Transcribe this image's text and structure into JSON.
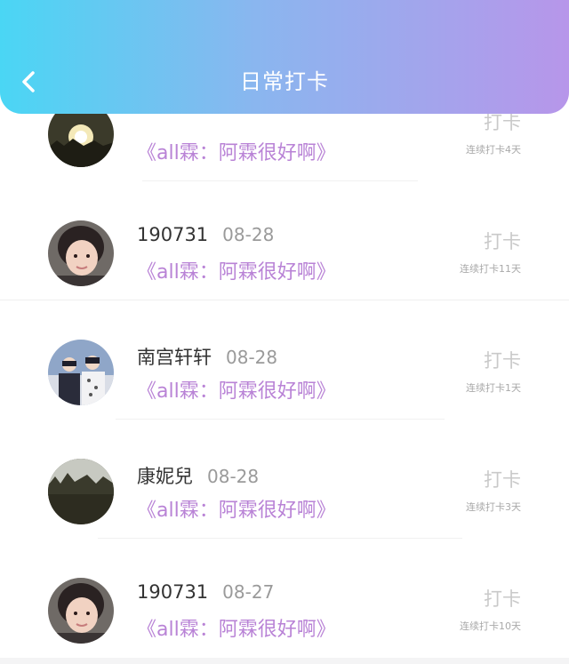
{
  "header": {
    "title": "日常打卡"
  },
  "rows": [
    {
      "name": "",
      "date": "",
      "book": "《all霖：阿霖很好啊》",
      "action": "打卡",
      "streak": "连续打卡4天",
      "avatar": "sunset"
    },
    {
      "name": "190731",
      "date": "08-28",
      "book": "《all霖：阿霖很好啊》",
      "action": "打卡",
      "streak": "连续打卡11天",
      "avatar": "girl"
    },
    {
      "name": "南宫轩轩",
      "date": "08-28",
      "book": "《all霖：阿霖很好啊》",
      "action": "打卡",
      "streak": "连续打卡1天",
      "avatar": "boys"
    },
    {
      "name": "康妮兒",
      "date": "08-28",
      "book": "《all霖：阿霖很好啊》",
      "action": "打卡",
      "streak": "连续打卡3天",
      "avatar": "sunset"
    },
    {
      "name": "190731",
      "date": "08-27",
      "book": "《all霖：阿霖很好啊》",
      "action": "打卡",
      "streak": "连续打卡10天",
      "avatar": "girl"
    }
  ],
  "colors": {
    "gradient_start": "#4ad6f4",
    "gradient_end": "#b796ea",
    "book_title": "#b983d6"
  }
}
